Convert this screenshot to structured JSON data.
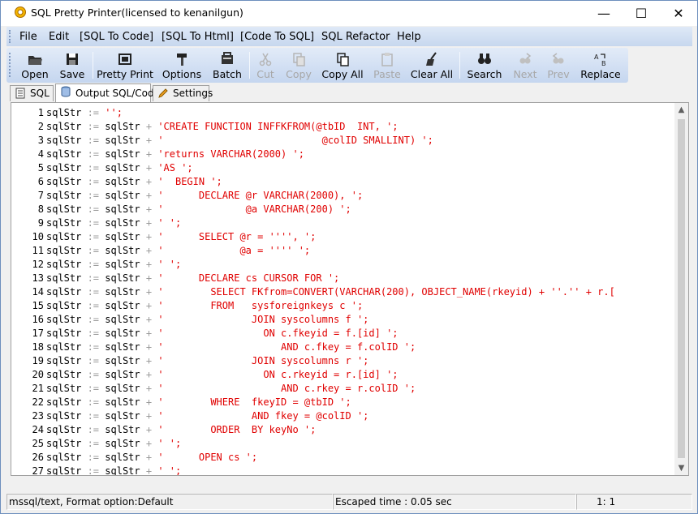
{
  "window": {
    "title": "SQL Pretty Printer(licensed to kenanilgun)",
    "minimize": "—",
    "maximize": "☐",
    "close": "✕"
  },
  "menu": [
    "File",
    "Edit",
    "[SQL To Code]",
    "[SQL To Html]",
    "[Code To SQL]",
    "SQL Refactor",
    "Help"
  ],
  "toolbar": [
    {
      "label": "Open",
      "icon": "open-folder-icon",
      "enabled": true
    },
    {
      "label": "Save",
      "icon": "floppy-disk-icon",
      "enabled": true
    },
    {
      "label": "Pretty Print",
      "icon": "pretty-print-icon",
      "enabled": true
    },
    {
      "label": "Options",
      "icon": "hammer-icon",
      "enabled": true
    },
    {
      "label": "Batch",
      "icon": "batch-icon",
      "enabled": true
    },
    {
      "label": "Cut",
      "icon": "scissors-icon",
      "enabled": false
    },
    {
      "label": "Copy",
      "icon": "copy-icon",
      "enabled": false
    },
    {
      "label": "Copy All",
      "icon": "copy-all-icon",
      "enabled": true
    },
    {
      "label": "Paste",
      "icon": "paste-icon",
      "enabled": false
    },
    {
      "label": "Clear All",
      "icon": "broom-icon",
      "enabled": true
    },
    {
      "label": "Search",
      "icon": "binoculars-icon",
      "enabled": true
    },
    {
      "label": "Next",
      "icon": "find-next-icon",
      "enabled": false
    },
    {
      "label": "Prev",
      "icon": "find-prev-icon",
      "enabled": false
    },
    {
      "label": "Replace",
      "icon": "replace-icon",
      "enabled": true
    }
  ],
  "tabs": [
    {
      "label": "SQL",
      "icon": "sql-doc-icon",
      "active": false
    },
    {
      "label": "Output SQL/Code",
      "icon": "database-icon",
      "active": true
    },
    {
      "label": "Settings",
      "icon": "pencil-icon",
      "active": false
    }
  ],
  "code": {
    "var": "sqlStr",
    "lines": [
      {
        "n": "1",
        "op": ":= ",
        "plus": false,
        "str": "'';"
      },
      {
        "n": "2",
        "op": ":= sqlStr + ",
        "plus": true,
        "str": "'CREATE FUNCTION INFFKFROM(@tbID  INT, ';"
      },
      {
        "n": "3",
        "op": ":= sqlStr + ",
        "plus": true,
        "str": "'                           @colID SMALLINT) ';"
      },
      {
        "n": "4",
        "op": ":= sqlStr + ",
        "plus": true,
        "str": "'returns VARCHAR(2000) ';"
      },
      {
        "n": "5",
        "op": ":= sqlStr + ",
        "plus": true,
        "str": "'AS ';"
      },
      {
        "n": "6",
        "op": ":= sqlStr + ",
        "plus": true,
        "str": "'  BEGIN ';"
      },
      {
        "n": "7",
        "op": ":= sqlStr + ",
        "plus": true,
        "str": "'      DECLARE @r VARCHAR(2000), ';"
      },
      {
        "n": "8",
        "op": ":= sqlStr + ",
        "plus": true,
        "str": "'              @a VARCHAR(200) ';"
      },
      {
        "n": "9",
        "op": ":= sqlStr + ",
        "plus": true,
        "str": "' ';"
      },
      {
        "n": "10",
        "op": ":= sqlStr + ",
        "plus": true,
        "str": "'      SELECT @r = '''', ';"
      },
      {
        "n": "11",
        "op": ":= sqlStr + ",
        "plus": true,
        "str": "'             @a = '''' ';"
      },
      {
        "n": "12",
        "op": ":= sqlStr + ",
        "plus": true,
        "str": "' ';"
      },
      {
        "n": "13",
        "op": ":= sqlStr + ",
        "plus": true,
        "str": "'      DECLARE cs CURSOR FOR ';"
      },
      {
        "n": "14",
        "op": ":= sqlStr + ",
        "plus": true,
        "str": "'        SELECT FKfrom=CONVERT(VARCHAR(200), OBJECT_NAME(rkeyid) + ''.'' + r.["
      },
      {
        "n": "15",
        "op": ":= sqlStr + ",
        "plus": true,
        "str": "'        FROM   sysforeignkeys c ';"
      },
      {
        "n": "16",
        "op": ":= sqlStr + ",
        "plus": true,
        "str": "'               JOIN syscolumns f ';"
      },
      {
        "n": "17",
        "op": ":= sqlStr + ",
        "plus": true,
        "str": "'                 ON c.fkeyid = f.[id] ';"
      },
      {
        "n": "18",
        "op": ":= sqlStr + ",
        "plus": true,
        "str": "'                    AND c.fkey = f.colID ';"
      },
      {
        "n": "19",
        "op": ":= sqlStr + ",
        "plus": true,
        "str": "'               JOIN syscolumns r ';"
      },
      {
        "n": "20",
        "op": ":= sqlStr + ",
        "plus": true,
        "str": "'                 ON c.rkeyid = r.[id] ';"
      },
      {
        "n": "21",
        "op": ":= sqlStr + ",
        "plus": true,
        "str": "'                    AND c.rkey = r.colID ';"
      },
      {
        "n": "22",
        "op": ":= sqlStr + ",
        "plus": true,
        "str": "'        WHERE  fkeyID = @tbID ';"
      },
      {
        "n": "23",
        "op": ":= sqlStr + ",
        "plus": true,
        "str": "'               AND fkey = @colID ';"
      },
      {
        "n": "24",
        "op": ":= sqlStr + ",
        "plus": true,
        "str": "'        ORDER  BY keyNo ';"
      },
      {
        "n": "25",
        "op": ":= sqlStr + ",
        "plus": true,
        "str": "' ';"
      },
      {
        "n": "26",
        "op": ":= sqlStr + ",
        "plus": true,
        "str": "'      OPEN cs ';"
      },
      {
        "n": "27",
        "op": ":= sqlStr + ",
        "plus": true,
        "str": "' ';"
      }
    ]
  },
  "status": {
    "mode": "mssql/text, Format option:Default",
    "elapsed": "Escaped time : 0.05 sec",
    "cursor": "1:  1"
  },
  "colors": {
    "string": "#e00000",
    "operator": "#9b9b9b",
    "menubar": "#c7d7ee"
  }
}
